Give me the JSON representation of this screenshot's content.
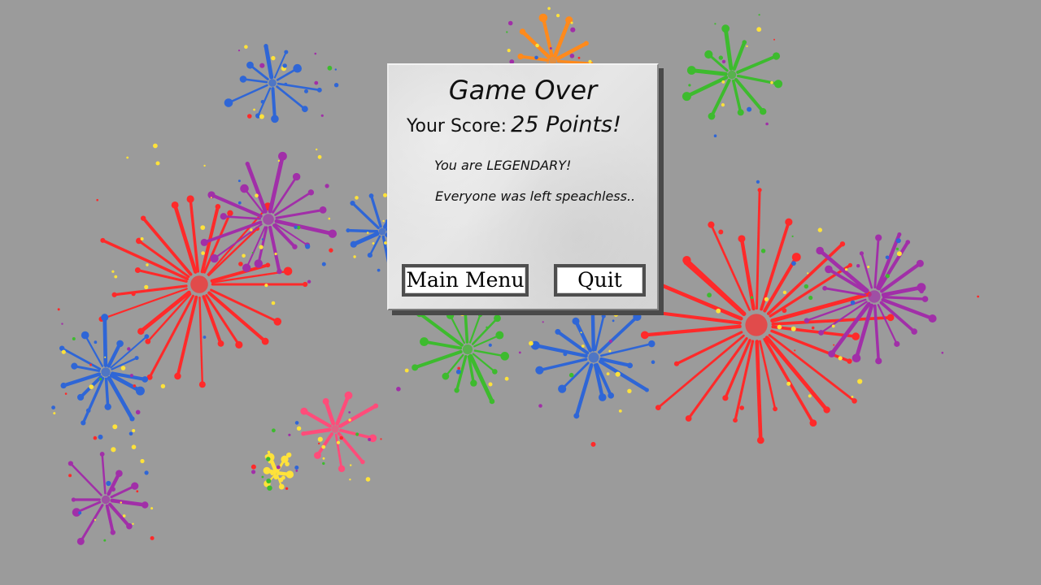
{
  "dialog": {
    "title": "Game Over",
    "score_label": "Your Score:",
    "score_value": "25 Points!",
    "rank_text": "You are LEGENDARY!",
    "rank_description": "Everyone was left speachless..",
    "buttons": {
      "main_menu": "Main Menu",
      "quit": "Quit"
    }
  },
  "colors": {
    "background": "#9b9b9b",
    "red": "#ff2a2a",
    "purple": "#a12fa8",
    "blue": "#2f66d6",
    "green": "#3dbb2e",
    "orange": "#ff8a1c",
    "yellow": "#ffe23a",
    "pink": "#ff4c7a"
  }
}
